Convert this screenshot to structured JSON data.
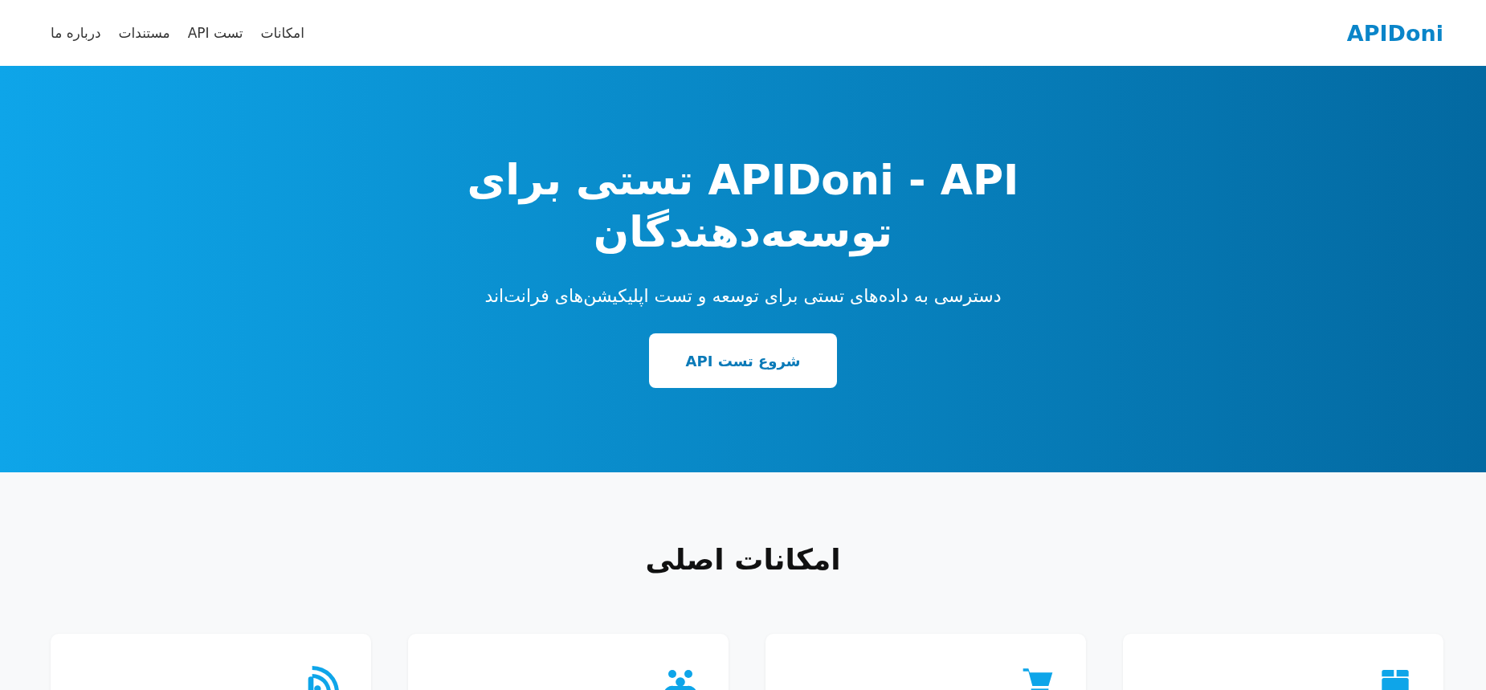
{
  "header": {
    "logo": "APIDoni",
    "nav": [
      {
        "label": "امکانات"
      },
      {
        "label": "تست API"
      },
      {
        "label": "مستندات"
      },
      {
        "label": "درباره ما"
      }
    ]
  },
  "hero": {
    "title": "APIDoni - API تستی برای توسعه‌دهندگان",
    "subtitle": "دسترسی به داده‌های تستی برای توسعه و تست اپلیکیشن‌های فرانت‌اند",
    "button": "شروع تست API"
  },
  "features": {
    "heading": "امکانات اصلی",
    "cards": [
      {
        "kind": "box"
      },
      {
        "kind": "cart"
      },
      {
        "kind": "users"
      },
      {
        "kind": "feed"
      }
    ]
  }
}
